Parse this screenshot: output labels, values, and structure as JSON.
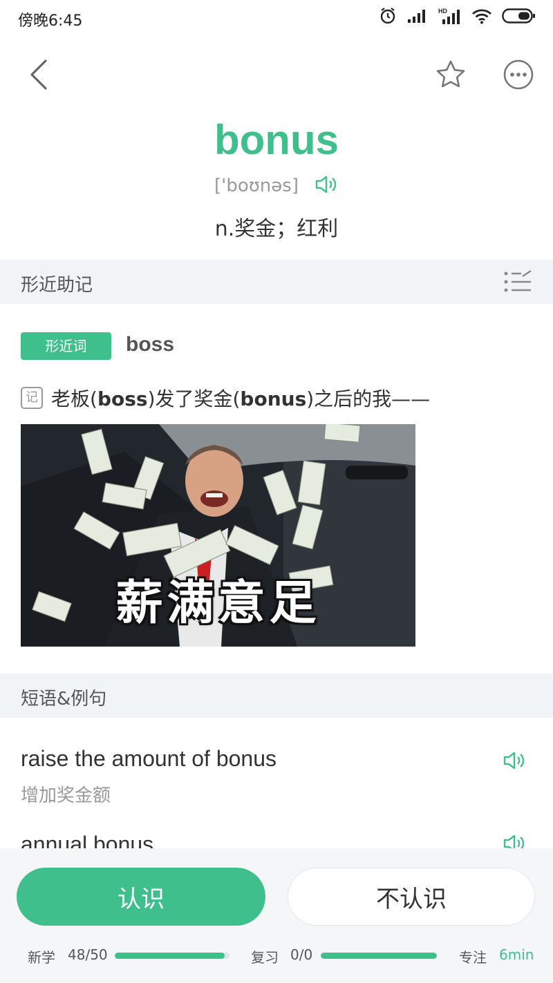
{
  "status_bar": {
    "time": "傍晚6:45",
    "icons": [
      "alarm-icon",
      "signal-icon",
      "hd-signal-icon",
      "wifi-icon",
      "battery-icon"
    ]
  },
  "nav": {
    "icons": [
      "back-icon",
      "star-icon",
      "more-icon"
    ]
  },
  "word": {
    "headword": "bonus",
    "phonetic": "['boʊnəs]",
    "meaning": "n.奖金；红利"
  },
  "mnemonic_section": {
    "title": "形近助记",
    "tag": "形近词",
    "similar_word": "boss",
    "note_icon": "记",
    "note_parts": [
      "老板(",
      "boss",
      ")发了奖金(",
      "bonus",
      ")之后的我——"
    ],
    "image_caption": "薪满意足"
  },
  "phrases_section": {
    "title": "短语&例句",
    "items": [
      {
        "en": "raise the amount of bonus",
        "zh": "增加奖金额"
      },
      {
        "en": "annual bonus",
        "zh": ""
      }
    ]
  },
  "actions": {
    "know_label": "认识",
    "unknown_label": "不认识"
  },
  "progress": {
    "new_label": "新学",
    "new_count": "48/50",
    "new_fraction": 0.96,
    "review_label": "复习",
    "review_count": "0/0",
    "review_fraction": 1.0,
    "focus_label": "专注",
    "focus_time": "6min"
  },
  "colors": {
    "accent": "#3fbf8c",
    "section_bg": "#f1f4f7",
    "muted_text": "#999999"
  }
}
